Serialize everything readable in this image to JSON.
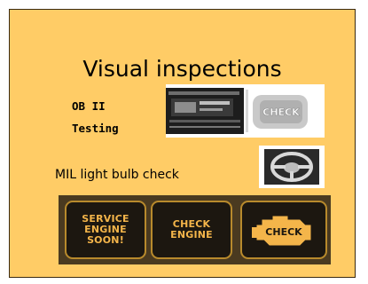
{
  "slide": {
    "title": "Visual inspections",
    "obd_label_line1": "OB II",
    "obd_label_line2": "Testing",
    "mil_label": "MIL light bulb check"
  },
  "obd_image": {
    "icon": "obd-scanner-photo-icon",
    "badge_text": "CHECK"
  },
  "mil_image": {
    "icon": "steering-wheel-icon"
  },
  "warning_lamps": [
    {
      "label": "SERVICE\nENGINE\nSOON!",
      "icon": "service-engine-soon-icon"
    },
    {
      "label": "CHECK\nENGINE",
      "icon": "check-engine-text-icon"
    },
    {
      "label": "CHECK",
      "icon": "engine-icon"
    }
  ],
  "colors": {
    "slide_background": "#ffcc66",
    "lamp_text": "#f4b54a",
    "lamp_background": "#1c1710"
  }
}
